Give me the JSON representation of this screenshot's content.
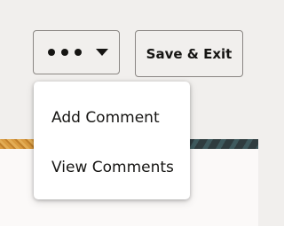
{
  "toolbar": {
    "more_actions": {
      "icon": "more-options-icon",
      "caret_icon": "chevron-down-icon"
    },
    "save_exit_label": "Save & Exit"
  },
  "menu": {
    "items": [
      {
        "label": "Add Comment"
      },
      {
        "label": "View Comments"
      }
    ]
  },
  "colors": {
    "toolbar_bg": "#f1efed",
    "content_bg": "#fbf9f8",
    "text": "#161513",
    "border": "#8a8683",
    "banner_dark": "#2f3c3f",
    "banner_accent": "#d89a3e"
  }
}
